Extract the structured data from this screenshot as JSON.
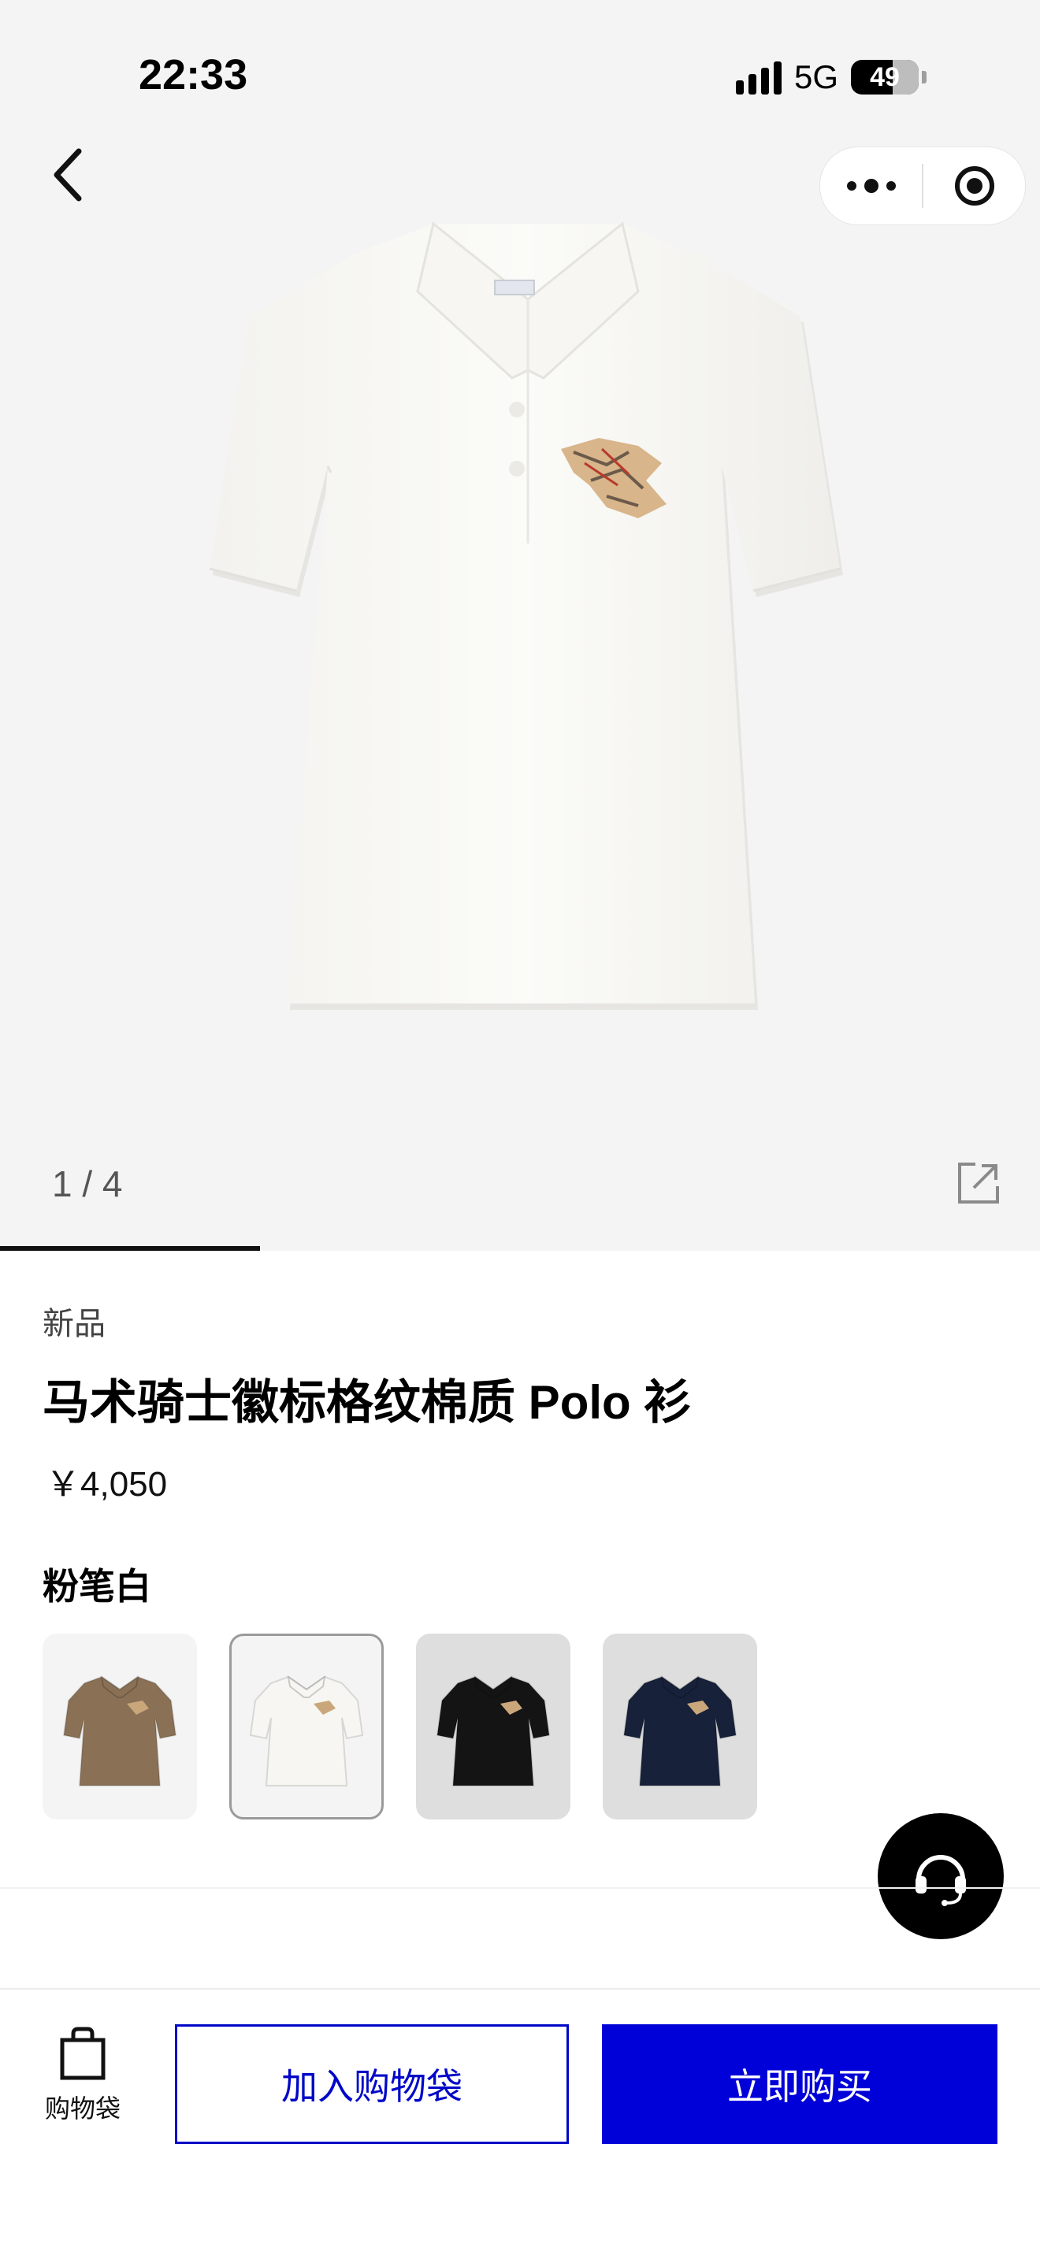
{
  "status_bar": {
    "time": "22:33",
    "network": "5G",
    "battery": "49",
    "battery_level": 0.49
  },
  "gallery": {
    "counter": "1 / 4",
    "current": 1,
    "total": 4
  },
  "product": {
    "badge": "新品",
    "title": "马术骑士徽标格纹棉质 Polo 衫",
    "price": "￥4,050",
    "selected_color": "粉笔白"
  },
  "swatches": [
    {
      "name": "brown",
      "bg": "#f4f4f4",
      "shirt": "#8a7156",
      "selected": false
    },
    {
      "name": "white",
      "bg": "#f4f4f4",
      "shirt": "#f7f6f2",
      "selected": true
    },
    {
      "name": "black",
      "bg": "#dedede",
      "shirt": "#141414",
      "selected": false
    },
    {
      "name": "navy",
      "bg": "#dedede",
      "shirt": "#17213a",
      "selected": false
    }
  ],
  "bottom_bar": {
    "bag_label": "购物袋",
    "add_to_bag": "加入购物袋",
    "buy_now": "立即购买"
  },
  "colors": {
    "accent": "#0000d8",
    "accent_border": "#0007c8",
    "hero_bg": "#f4f4f4",
    "shirt": "#f7f6f2"
  }
}
